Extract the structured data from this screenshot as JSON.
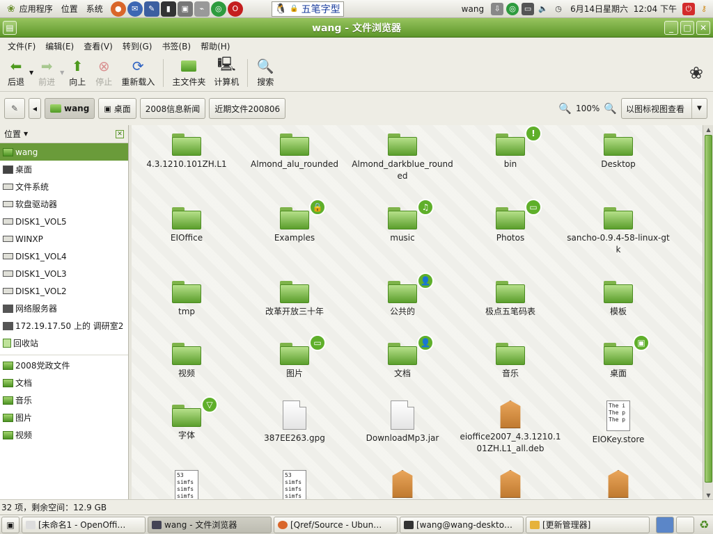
{
  "top_panel": {
    "menus": [
      "应用程序",
      "位置",
      "系统"
    ],
    "ime_label": "五笔字型",
    "user": "wang",
    "clock": "6月14日星期六  12:04 下午"
  },
  "window": {
    "title": "wang - 文件浏览器"
  },
  "menubar": [
    "文件(F)",
    "编辑(E)",
    "查看(V)",
    "转到(G)",
    "书签(B)",
    "帮助(H)"
  ],
  "toolbar": {
    "back": "后退",
    "forward": "前进",
    "up": "向上",
    "stop": "停止",
    "reload": "重新载入",
    "home": "主文件夹",
    "computer": "计算机",
    "search": "搜索"
  },
  "locbar": {
    "crumbs": [
      "wang",
      "桌面",
      "2008信息新闻",
      "近期文件200806"
    ],
    "zoom": "100%",
    "view_mode": "以图标视图查看"
  },
  "sidebar": {
    "title": "位置",
    "items": [
      "wang",
      "桌面",
      "文件系统",
      "软盘驱动器",
      "DISK1_VOL5",
      "WINXP",
      "DISK1_VOL4",
      "DISK1_VOL3",
      "DISK1_VOL2",
      "网络服务器",
      "172.19.17.50 上的 调研室2",
      "回收站"
    ],
    "bookmarks": [
      "2008党政文件",
      "文档",
      "音乐",
      "图片",
      "视频"
    ]
  },
  "files": [
    {
      "name": "4.3.1210.101ZH.L1",
      "type": "folder"
    },
    {
      "name": "Almond_alu_rounded",
      "type": "folder"
    },
    {
      "name": "Almond_darkblue_rounded",
      "type": "folder"
    },
    {
      "name": "bin",
      "type": "folder",
      "emblem": "!"
    },
    {
      "name": "Desktop",
      "type": "folder"
    },
    {
      "name": "EIOffice",
      "type": "folder"
    },
    {
      "name": "Examples",
      "type": "folder",
      "emblem": "lock"
    },
    {
      "name": "music",
      "type": "folder",
      "emblem": "note"
    },
    {
      "name": "Photos",
      "type": "folder",
      "emblem": "photo"
    },
    {
      "name": "sancho-0.9.4-58-linux-gtk",
      "type": "folder"
    },
    {
      "name": "tmp",
      "type": "folder"
    },
    {
      "name": "改革开放三十年",
      "type": "folder"
    },
    {
      "name": "公共的",
      "type": "folder",
      "emblem": "person"
    },
    {
      "name": "极点五笔码表",
      "type": "folder"
    },
    {
      "name": "模板",
      "type": "folder"
    },
    {
      "name": "视频",
      "type": "folder"
    },
    {
      "name": "图片",
      "type": "folder",
      "emblem": "photo"
    },
    {
      "name": "文档",
      "type": "folder",
      "emblem": "person"
    },
    {
      "name": "音乐",
      "type": "folder"
    },
    {
      "name": "桌面",
      "type": "folder",
      "emblem": "screen"
    },
    {
      "name": "字体",
      "type": "folder",
      "emblem": "down"
    },
    {
      "name": "387EE263.gpg",
      "type": "file"
    },
    {
      "name": "DownloadMp3.jar",
      "type": "file"
    },
    {
      "name": "eioffice2007_4.3.1210.101ZH.L1_all.deb",
      "type": "package"
    },
    {
      "name": "EIOKey.store",
      "type": "text",
      "preview": "The i\nThe p\nThe p"
    },
    {
      "name": "",
      "type": "text",
      "preview": "53\nsimfs\nsimfs\nsimfs"
    },
    {
      "name": "",
      "type": "text",
      "preview": "53\nsimfs\nsimfs\nsimfs"
    },
    {
      "name": "",
      "type": "package"
    },
    {
      "name": "",
      "type": "package"
    },
    {
      "name": "",
      "type": "package"
    }
  ],
  "status": "32 项，剩余空间：12.9 GB",
  "taskbar": [
    "[未命名1 - OpenOffi…",
    "wang - 文件浏览器",
    "[Qref/Source - Ubun…",
    "[wang@wang-deskto…",
    "[更新管理器]"
  ]
}
